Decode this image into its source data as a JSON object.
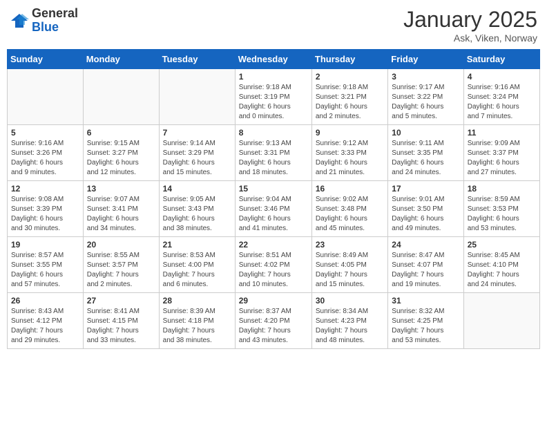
{
  "header": {
    "logo_general": "General",
    "logo_blue": "Blue",
    "month_title": "January 2025",
    "location": "Ask, Viken, Norway"
  },
  "weekdays": [
    "Sunday",
    "Monday",
    "Tuesday",
    "Wednesday",
    "Thursday",
    "Friday",
    "Saturday"
  ],
  "weeks": [
    [
      {
        "day": "",
        "info": ""
      },
      {
        "day": "",
        "info": ""
      },
      {
        "day": "",
        "info": ""
      },
      {
        "day": "1",
        "info": "Sunrise: 9:18 AM\nSunset: 3:19 PM\nDaylight: 6 hours\nand 0 minutes."
      },
      {
        "day": "2",
        "info": "Sunrise: 9:18 AM\nSunset: 3:21 PM\nDaylight: 6 hours\nand 2 minutes."
      },
      {
        "day": "3",
        "info": "Sunrise: 9:17 AM\nSunset: 3:22 PM\nDaylight: 6 hours\nand 5 minutes."
      },
      {
        "day": "4",
        "info": "Sunrise: 9:16 AM\nSunset: 3:24 PM\nDaylight: 6 hours\nand 7 minutes."
      }
    ],
    [
      {
        "day": "5",
        "info": "Sunrise: 9:16 AM\nSunset: 3:26 PM\nDaylight: 6 hours\nand 9 minutes."
      },
      {
        "day": "6",
        "info": "Sunrise: 9:15 AM\nSunset: 3:27 PM\nDaylight: 6 hours\nand 12 minutes."
      },
      {
        "day": "7",
        "info": "Sunrise: 9:14 AM\nSunset: 3:29 PM\nDaylight: 6 hours\nand 15 minutes."
      },
      {
        "day": "8",
        "info": "Sunrise: 9:13 AM\nSunset: 3:31 PM\nDaylight: 6 hours\nand 18 minutes."
      },
      {
        "day": "9",
        "info": "Sunrise: 9:12 AM\nSunset: 3:33 PM\nDaylight: 6 hours\nand 21 minutes."
      },
      {
        "day": "10",
        "info": "Sunrise: 9:11 AM\nSunset: 3:35 PM\nDaylight: 6 hours\nand 24 minutes."
      },
      {
        "day": "11",
        "info": "Sunrise: 9:09 AM\nSunset: 3:37 PM\nDaylight: 6 hours\nand 27 minutes."
      }
    ],
    [
      {
        "day": "12",
        "info": "Sunrise: 9:08 AM\nSunset: 3:39 PM\nDaylight: 6 hours\nand 30 minutes."
      },
      {
        "day": "13",
        "info": "Sunrise: 9:07 AM\nSunset: 3:41 PM\nDaylight: 6 hours\nand 34 minutes."
      },
      {
        "day": "14",
        "info": "Sunrise: 9:05 AM\nSunset: 3:43 PM\nDaylight: 6 hours\nand 38 minutes."
      },
      {
        "day": "15",
        "info": "Sunrise: 9:04 AM\nSunset: 3:46 PM\nDaylight: 6 hours\nand 41 minutes."
      },
      {
        "day": "16",
        "info": "Sunrise: 9:02 AM\nSunset: 3:48 PM\nDaylight: 6 hours\nand 45 minutes."
      },
      {
        "day": "17",
        "info": "Sunrise: 9:01 AM\nSunset: 3:50 PM\nDaylight: 6 hours\nand 49 minutes."
      },
      {
        "day": "18",
        "info": "Sunrise: 8:59 AM\nSunset: 3:53 PM\nDaylight: 6 hours\nand 53 minutes."
      }
    ],
    [
      {
        "day": "19",
        "info": "Sunrise: 8:57 AM\nSunset: 3:55 PM\nDaylight: 6 hours\nand 57 minutes."
      },
      {
        "day": "20",
        "info": "Sunrise: 8:55 AM\nSunset: 3:57 PM\nDaylight: 7 hours\nand 2 minutes."
      },
      {
        "day": "21",
        "info": "Sunrise: 8:53 AM\nSunset: 4:00 PM\nDaylight: 7 hours\nand 6 minutes."
      },
      {
        "day": "22",
        "info": "Sunrise: 8:51 AM\nSunset: 4:02 PM\nDaylight: 7 hours\nand 10 minutes."
      },
      {
        "day": "23",
        "info": "Sunrise: 8:49 AM\nSunset: 4:05 PM\nDaylight: 7 hours\nand 15 minutes."
      },
      {
        "day": "24",
        "info": "Sunrise: 8:47 AM\nSunset: 4:07 PM\nDaylight: 7 hours\nand 19 minutes."
      },
      {
        "day": "25",
        "info": "Sunrise: 8:45 AM\nSunset: 4:10 PM\nDaylight: 7 hours\nand 24 minutes."
      }
    ],
    [
      {
        "day": "26",
        "info": "Sunrise: 8:43 AM\nSunset: 4:12 PM\nDaylight: 7 hours\nand 29 minutes."
      },
      {
        "day": "27",
        "info": "Sunrise: 8:41 AM\nSunset: 4:15 PM\nDaylight: 7 hours\nand 33 minutes."
      },
      {
        "day": "28",
        "info": "Sunrise: 8:39 AM\nSunset: 4:18 PM\nDaylight: 7 hours\nand 38 minutes."
      },
      {
        "day": "29",
        "info": "Sunrise: 8:37 AM\nSunset: 4:20 PM\nDaylight: 7 hours\nand 43 minutes."
      },
      {
        "day": "30",
        "info": "Sunrise: 8:34 AM\nSunset: 4:23 PM\nDaylight: 7 hours\nand 48 minutes."
      },
      {
        "day": "31",
        "info": "Sunrise: 8:32 AM\nSunset: 4:25 PM\nDaylight: 7 hours\nand 53 minutes."
      },
      {
        "day": "",
        "info": ""
      }
    ]
  ]
}
